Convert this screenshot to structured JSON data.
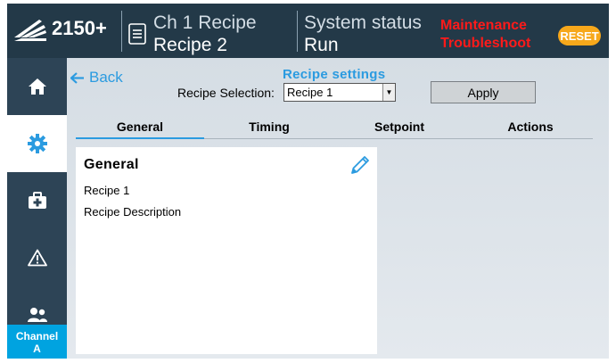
{
  "header": {
    "model": "2150+",
    "recipe_label": "Ch 1 Recipe",
    "recipe_value": "Recipe 2",
    "status_label": "System status",
    "status_value": "Run",
    "alarm_line1": "Maintenance",
    "alarm_line2": "Troubleshoot",
    "reset_label": "RESET"
  },
  "sidebar": {
    "items": [
      {
        "icon": "home-icon"
      },
      {
        "icon": "gear-icon",
        "active": true
      },
      {
        "icon": "first-aid-kit-icon"
      },
      {
        "icon": "warning-icon"
      },
      {
        "icon": "users-icon"
      }
    ],
    "channel_label": "Channel",
    "channel_value": "A"
  },
  "page": {
    "back_label": "Back",
    "section_title": "Recipe settings",
    "selection_label": "Recipe Selection:",
    "selection_value": "Recipe 1",
    "apply_label": "Apply"
  },
  "tabs": [
    {
      "label": "General",
      "active": true
    },
    {
      "label": "Timing"
    },
    {
      "label": "Setpoint"
    },
    {
      "label": "Actions"
    }
  ],
  "card": {
    "title": "General",
    "name": "Recipe 1",
    "description": "Recipe Description"
  },
  "colors": {
    "header_bg": "#233948",
    "sidebar_bg": "#2d4456",
    "accent_blue": "#2b9be0",
    "alarm_red": "#ff1a1a",
    "reset_orange": "#f7a81b",
    "channel_blue": "#00a3e0"
  }
}
